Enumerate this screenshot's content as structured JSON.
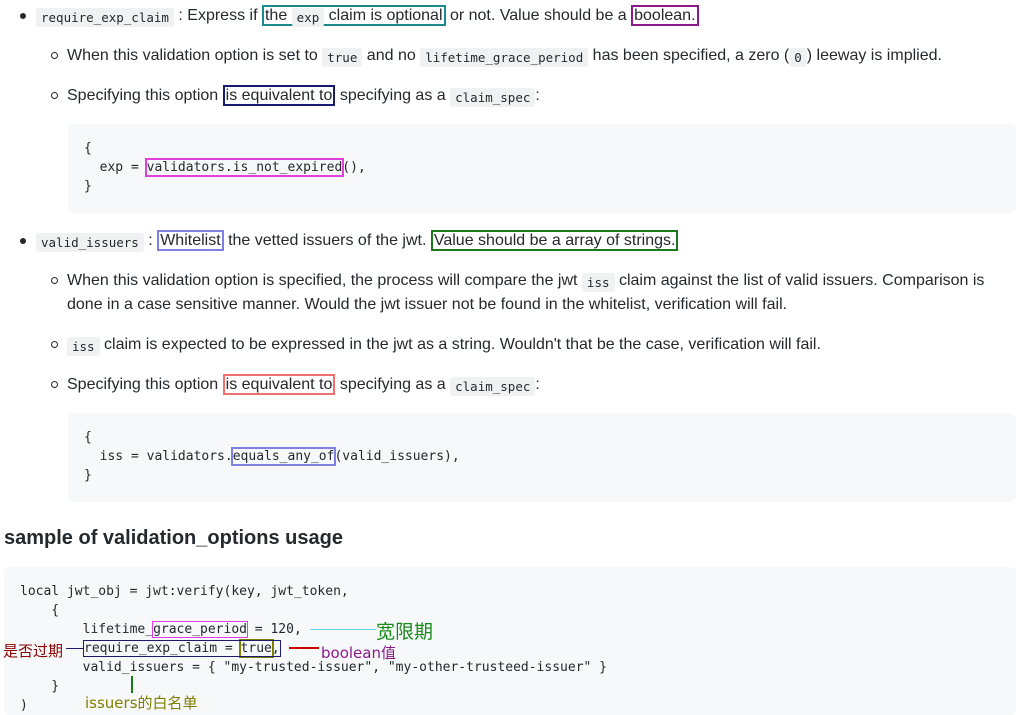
{
  "item1": {
    "key": "require_exp_claim",
    "sep": " : Express if ",
    "hl_claim_optional_pre": "the ",
    "code_exp": "exp",
    "hl_claim_optional_post": " claim is optional",
    "mid": " or not. Value should be a ",
    "hl_boolean": "boolean.",
    "sub1": {
      "t1": "When this validation option is set to ",
      "code_true": "true",
      "t2": " and no ",
      "code_lgp": "lifetime_grace_period",
      "t3": " has been specified, a zero (",
      "code_zero": "0",
      "t4": ") leeway is implied."
    },
    "sub2": {
      "t1": "Specifying this option ",
      "hl": "is equivalent to",
      "t2": " specifying as a ",
      "code": "claim_spec",
      "t3": ":"
    },
    "code_lines": [
      "{",
      "  exp = ",
      "}"
    ],
    "code_fn": "validators.is_not_expired",
    "code_tail": "(),"
  },
  "item2": {
    "key": "valid_issuers",
    "sep": " : ",
    "hl_whitelist": "Whitelist",
    "mid": " the vetted issuers of the jwt. ",
    "hl_value": "Value should be a array of strings.",
    "sub1": {
      "t1": "When this validation option is specified, the process will compare the jwt ",
      "code_iss": "iss",
      "t2": " claim against the list of valid issuers. Comparison is",
      "line2": "done in a case sensitive manner. Would the jwt issuer not be found in the whitelist, verification will fail."
    },
    "sub2": {
      "code_iss": "iss",
      "t1": " claim is expected to be expressed in the jwt as a string. Wouldn't that be the case, verification will fail."
    },
    "sub3": {
      "t1": "Specifying this option ",
      "hl": "is equivalent to",
      "t2": " specifying as a ",
      "code": "claim_spec",
      "t3": ":"
    },
    "code_lines": [
      "{",
      "  iss = validators.",
      "}"
    ],
    "code_fn": "equals_any_of",
    "code_tail": "(valid_issuers),"
  },
  "section": {
    "heading": "sample of validation_options usage",
    "code": {
      "l1": "local jwt_obj = jwt:verify(key, jwt_token,",
      "l2": "    {",
      "l3a": "        lifetime_",
      "l3b": "grace_period",
      "l3c": " = 120,",
      "l4a": "require_exp_claim = ",
      "l4b": "true",
      "l4c": ",",
      "l5": "        valid_issuers = { \"my-trusted-issuer\", \"my-other-trusteed-issuer\" }",
      "l6": "    }",
      "l7": ")"
    }
  },
  "annotations": {
    "grace": "宽限期",
    "expired": "是否过期",
    "boolean": "boolean值",
    "issuers": "issuers的白名单"
  },
  "colors": {
    "teal": "#1a8a8a",
    "purple": "#8b1a8b",
    "navy": "#1a1a6e",
    "magenta": "#e040e0",
    "lavender": "#8080e0",
    "green": "#1a7a1a",
    "salmon": "#f07070",
    "cyan": "#5ad8e8",
    "red": "#cc0000",
    "darkred": "#8b0000",
    "olive": "#808000"
  }
}
